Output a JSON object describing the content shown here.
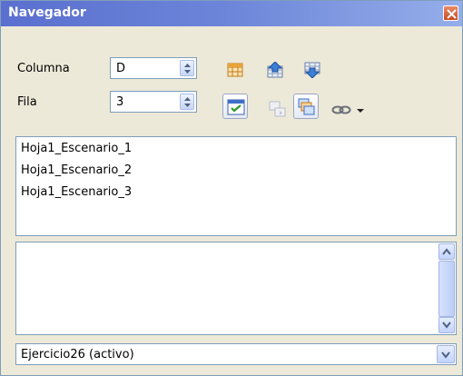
{
  "window": {
    "title": "Navegador"
  },
  "controls": {
    "column_label": "Columna",
    "column_value": "D",
    "row_label": "Fila",
    "row_value": "3"
  },
  "icons": {
    "toolbar": [
      "data-range-icon",
      "start-icon",
      "end-icon",
      "toggle-icon",
      "scenarios-icon",
      "drag-mode-icon",
      "link-icon",
      "dropdown-arrow-icon"
    ]
  },
  "scenarios": {
    "items": [
      "Hoja1_Escenario_1",
      "Hoja1_Escenario_2",
      "Hoja1_Escenario_3"
    ]
  },
  "document_selector": {
    "value": "Ejercicio26 (activo)"
  }
}
